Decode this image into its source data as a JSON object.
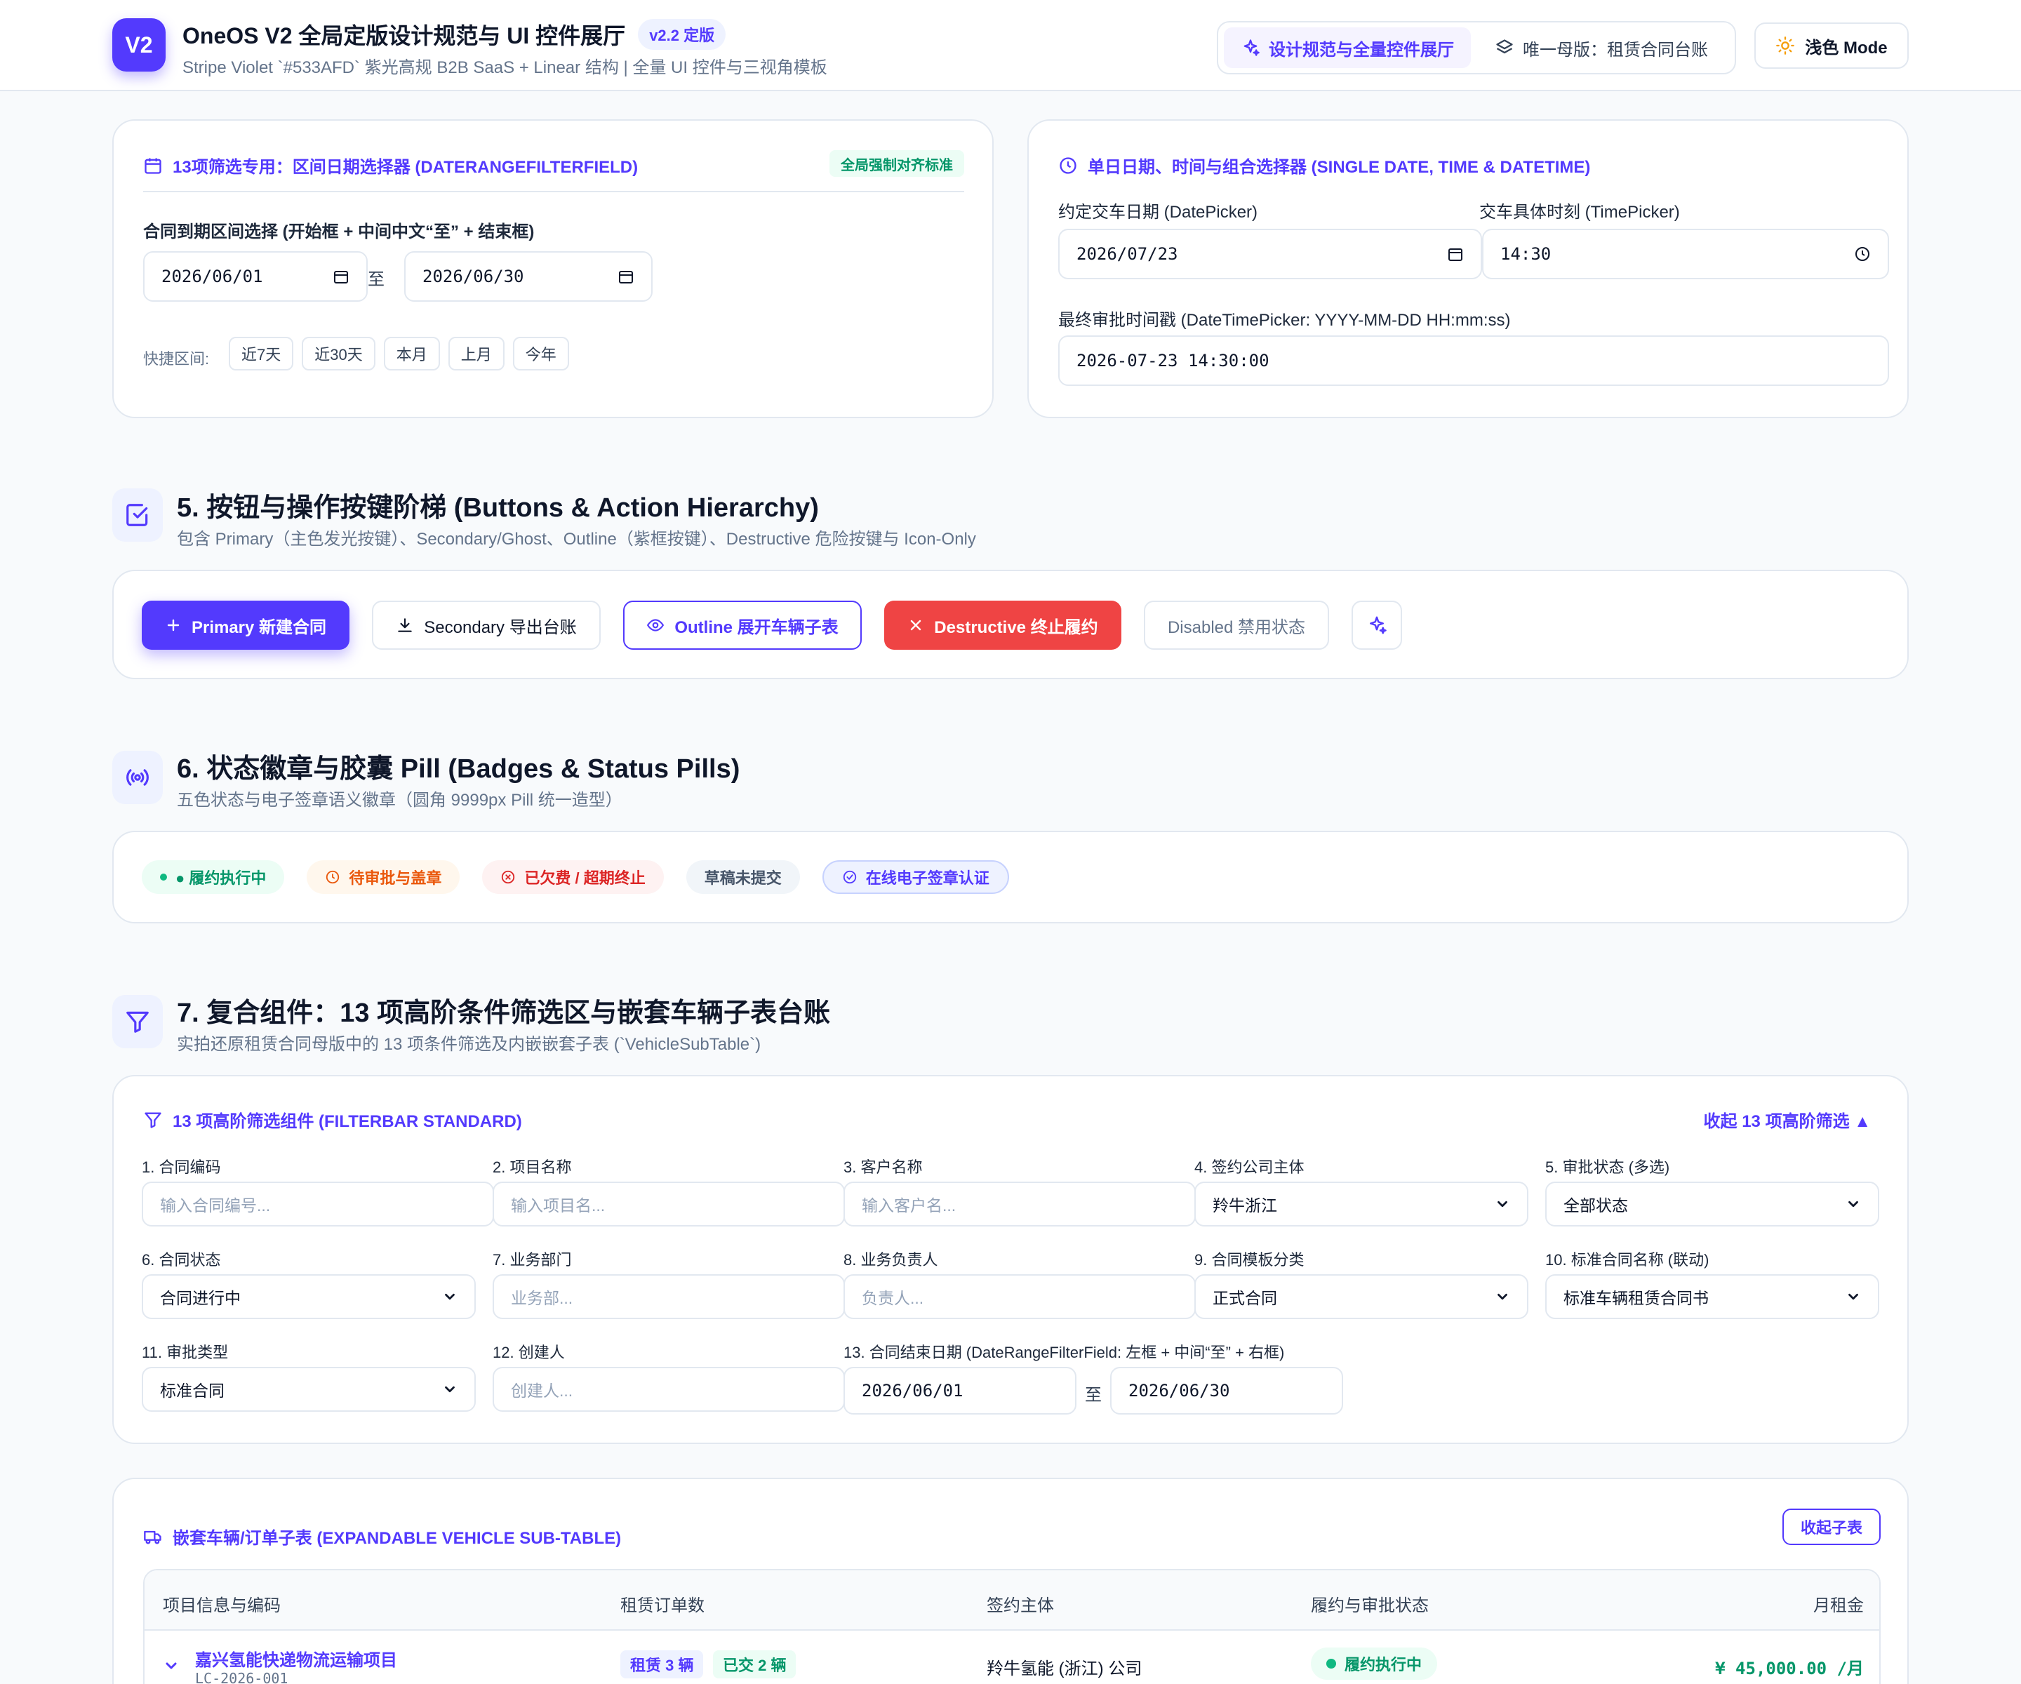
{
  "header": {
    "logo": "V2",
    "title": "OneOS V2 全局定版设计规范与 UI 控件展厅",
    "version": "v2.2 定版",
    "subtitle": "Stripe Violet `#533AFD` 紫光高规 B2B SaaS + Linear 结构 | 全量 UI 控件与三视角模板",
    "nav": [
      {
        "label": "设计规范与全量控件展厅",
        "icon": "sparkle-icon"
      },
      {
        "label": "唯一母版：租赁合同台账",
        "icon": "layers-icon"
      }
    ],
    "mode_label": "浅色 Mode",
    "accent": "#533AFD"
  },
  "date_range_card": {
    "title": "13项筛选专用：区间日期选择器 (DATERANGEFILTERFIELD)",
    "badge": "全局强制对齐标准",
    "label": "合同到期区间选择 (开始框 + 中间中文“至” + 结束框)",
    "start": "2026/06/01",
    "to": "至",
    "end": "2026/06/30",
    "quick_label": "快捷区间:",
    "quick": [
      "近7天",
      "近30天",
      "本月",
      "上月",
      "今年"
    ]
  },
  "single_date_card": {
    "title": "单日日期、时间与组合选择器 (SINGLE DATE, TIME & DATETIME)",
    "date_label": "约定交车日期 (DatePicker)",
    "date_value": "2026/07/23",
    "time_label": "交车具体时刻 (TimePicker)",
    "time_value": "14:30",
    "datetime_label": "最终审批时间戳 (DateTimePicker: YYYY-MM-DD HH:mm:ss)",
    "datetime_value": "2026-07-23 14:30:00"
  },
  "section5": {
    "title": "5. 按钮与操作按键阶梯 (Buttons & Action Hierarchy)",
    "subtitle": "包含 Primary（主色发光按键）、Secondary/Ghost、Outline（紫框按键）、Destructive 危险按键与 Icon-Only",
    "primary": "Primary 新建合同",
    "secondary": "Secondary 导出台账",
    "outline": "Outline 展开车辆子表",
    "destructive": "Destructive 终止履约",
    "disabled": "Disabled 禁用状态",
    "destructive_color": "#EF4444"
  },
  "section6": {
    "title": "6. 状态徽章与胶囊 Pill (Badges & Status Pills)",
    "subtitle": "五色状态与电子签章语义徽章（圆角 9999px Pill 统一造型）",
    "pills": [
      "● 履约执行中",
      "待审批与盖章",
      "已欠费 / 超期终止",
      "草稿未提交",
      "在线电子签章认证"
    ]
  },
  "section7": {
    "title": "7. 复合组件：13 项高阶条件筛选区与嵌套车辆子表台账",
    "subtitle": "实拍还原租赁合同母版中的 13 项条件筛选及内嵌嵌套子表 (`VehicleSubTable`)"
  },
  "filter": {
    "title": "13 项高阶筛选组件 (FILTERBAR STANDARD)",
    "collapse": "收起 13 项高阶筛选 ▲",
    "f1": {
      "label": "1. 合同编码",
      "placeholder": "输入合同编号..."
    },
    "f2": {
      "label": "2. 项目名称",
      "placeholder": "输入项目名..."
    },
    "f3": {
      "label": "3. 客户名称",
      "placeholder": "输入客户名..."
    },
    "f4": {
      "label": "4. 签约公司主体",
      "value": "羚牛浙江"
    },
    "f5": {
      "label": "5. 审批状态 (多选)",
      "value": "全部状态"
    },
    "f6": {
      "label": "6. 合同状态",
      "value": "合同进行中"
    },
    "f7": {
      "label": "7. 业务部门",
      "placeholder": "业务部..."
    },
    "f8": {
      "label": "8. 业务负责人",
      "placeholder": "负责人..."
    },
    "f9": {
      "label": "9. 合同模板分类",
      "value": "正式合同"
    },
    "f10": {
      "label": "10. 标准合同名称 (联动)",
      "value": "标准车辆租赁合同书"
    },
    "f11": {
      "label": "11. 审批类型",
      "value": "标准合同"
    },
    "f12": {
      "label": "12. 创建人",
      "placeholder": "创建人..."
    },
    "f13": {
      "label": "13. 合同结束日期 (DateRangeFilterField: 左框 + 中间“至” + 右框)",
      "start": "2026/06/01",
      "to": "至",
      "end": "2026/06/30"
    }
  },
  "subtable": {
    "title": "嵌套车辆/订单子表 (EXPANDABLE VEHICLE SUB-TABLE)",
    "collapse": "收起子表",
    "columns": [
      "项目信息与编码",
      "租赁订单数",
      "签约主体",
      "履约与审批状态",
      "月租金"
    ],
    "rows": [
      {
        "name": "嘉兴氢能快递物流运输项目",
        "code": "LC-2026-001",
        "tag1": "租赁 3 辆",
        "tag2": "已交 2 辆",
        "entity": "羚牛氢能 (浙江) 公司",
        "status": "履约执行中",
        "rent": "¥ 45,000.00 /月"
      }
    ]
  }
}
